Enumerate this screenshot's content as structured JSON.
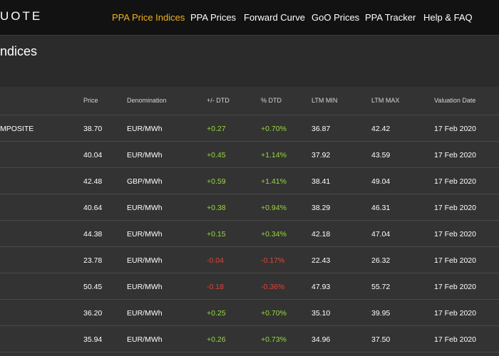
{
  "header": {
    "logo": "UOTE",
    "nav": [
      {
        "label": "PPA Price Indices",
        "active": true
      },
      {
        "label": "PPA Prices",
        "active": false
      },
      {
        "label": "Forward Curve",
        "active": false
      },
      {
        "label": "GoO Prices",
        "active": false
      },
      {
        "label": "PPA Tracker",
        "active": false
      },
      {
        "label": "Help & FAQ",
        "active": false
      }
    ]
  },
  "page": {
    "title": "ndices"
  },
  "table": {
    "columns": [
      "Price",
      "Denomination",
      "+/- DTD",
      "% DTD",
      "LTM MIN",
      "LTM MAX",
      "Valuation Date"
    ],
    "rows": [
      {
        "name": "MPOSITE",
        "price": "38.70",
        "denom": "EUR/MWh",
        "dtd": "+0.27",
        "pct": "+0.70%",
        "min": "36.87",
        "max": "42.42",
        "date": "17 Feb 2020",
        "trend": "pos"
      },
      {
        "name": "",
        "price": "40.04",
        "denom": "EUR/MWh",
        "dtd": "+0.45",
        "pct": "+1.14%",
        "min": "37.92",
        "max": "43.59",
        "date": "17 Feb 2020",
        "trend": "pos"
      },
      {
        "name": "",
        "price": "42.48",
        "denom": "GBP/MWh",
        "dtd": "+0.59",
        "pct": "+1.41%",
        "min": "38.41",
        "max": "49.04",
        "date": "17 Feb 2020",
        "trend": "pos"
      },
      {
        "name": "",
        "price": "40.64",
        "denom": "EUR/MWh",
        "dtd": "+0.38",
        "pct": "+0.94%",
        "min": "38.29",
        "max": "46.31",
        "date": "17 Feb 2020",
        "trend": "pos"
      },
      {
        "name": "",
        "price": "44.38",
        "denom": "EUR/MWh",
        "dtd": "+0.15",
        "pct": "+0.34%",
        "min": "42.18",
        "max": "47.04",
        "date": "17 Feb 2020",
        "trend": "pos"
      },
      {
        "name": "",
        "price": "23.78",
        "denom": "EUR/MWh",
        "dtd": "-0.04",
        "pct": "-0.17%",
        "min": "22.43",
        "max": "26.32",
        "date": "17 Feb 2020",
        "trend": "neg"
      },
      {
        "name": "",
        "price": "50.45",
        "denom": "EUR/MWh",
        "dtd": "-0.18",
        "pct": "-0.36%",
        "min": "47.93",
        "max": "55.72",
        "date": "17 Feb 2020",
        "trend": "neg"
      },
      {
        "name": "",
        "price": "36.20",
        "denom": "EUR/MWh",
        "dtd": "+0.25",
        "pct": "+0.70%",
        "min": "35.10",
        "max": "39.95",
        "date": "17 Feb 2020",
        "trend": "pos"
      },
      {
        "name": "",
        "price": "35.94",
        "denom": "EUR/MWh",
        "dtd": "+0.26",
        "pct": "+0.73%",
        "min": "34.96",
        "max": "37.50",
        "date": "17 Feb 2020",
        "trend": "pos"
      }
    ]
  },
  "colors": {
    "accent": "#f0b21e",
    "positive": "#99dc3c",
    "negative": "#e0443a",
    "topbar_bg": "#121212",
    "page_bg": "#2b2b2b",
    "table_bg": "#333333"
  }
}
